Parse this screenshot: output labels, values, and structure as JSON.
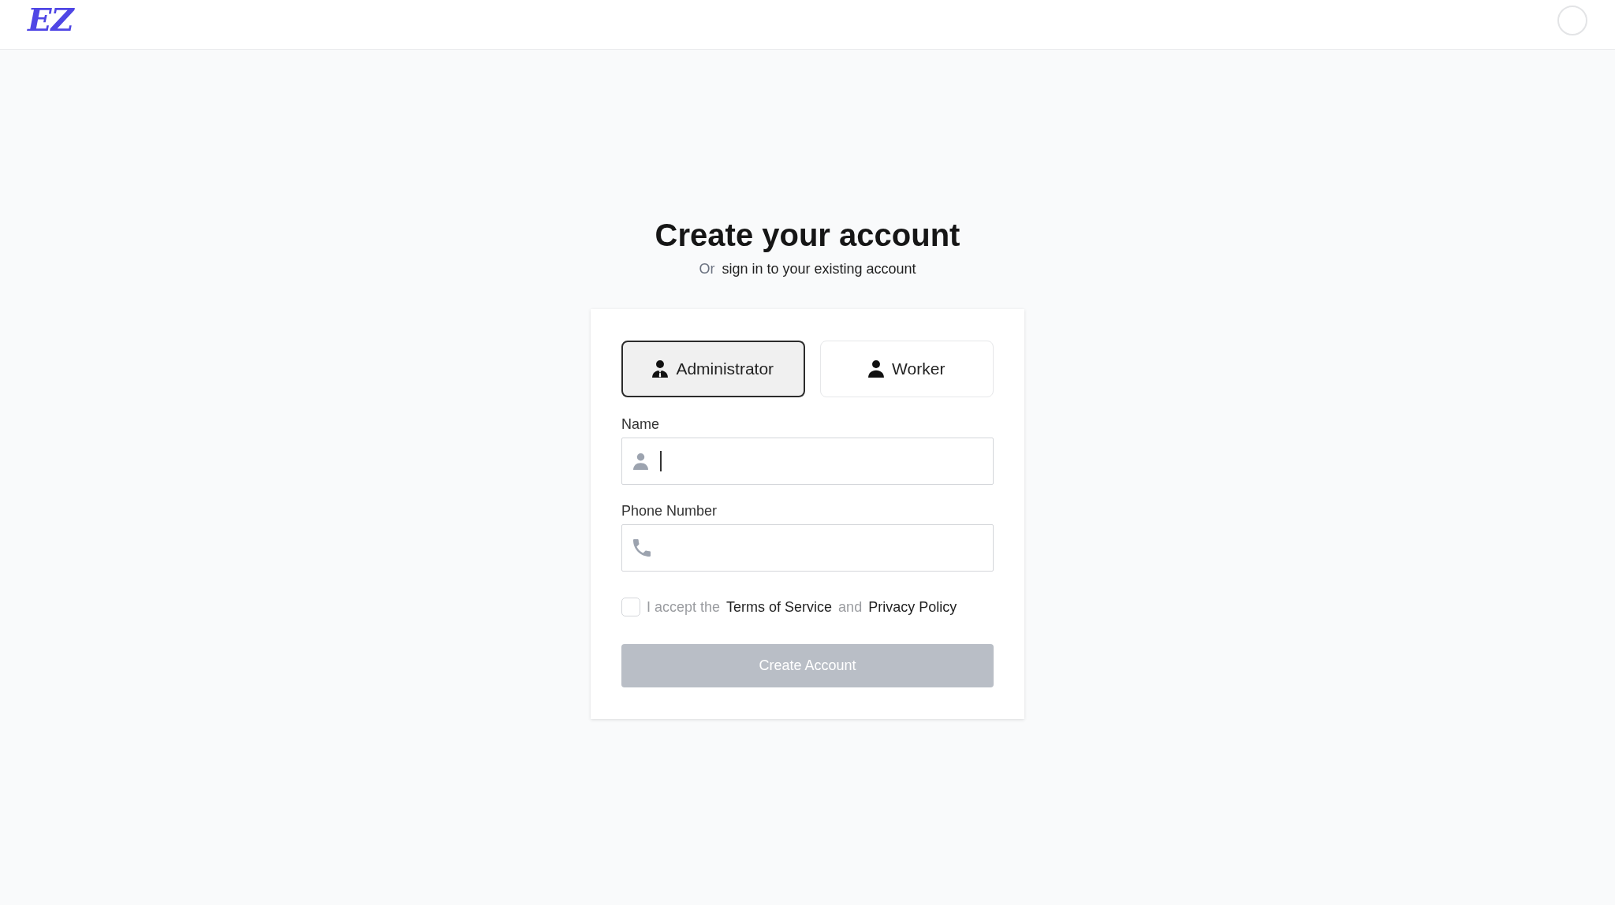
{
  "header": {
    "logo": "EZ"
  },
  "heading": "Create your account",
  "subtitle": {
    "prefix": "Or",
    "link": "sign in to your existing account"
  },
  "roles": [
    {
      "label": "Administrator",
      "kind": "administrator",
      "selected": true
    },
    {
      "label": "Worker",
      "kind": "worker",
      "selected": false
    }
  ],
  "fields": [
    {
      "label": "Name",
      "kind": "name",
      "focused": true
    },
    {
      "label": "Phone Number",
      "kind": "phone",
      "focused": false
    }
  ],
  "terms": {
    "checked": false,
    "parts": [
      {
        "text": "I accept the",
        "kind": "plain"
      },
      {
        "text": "Terms of Service",
        "kind": "link"
      },
      {
        "text": "and",
        "kind": "plain"
      },
      {
        "text": "Privacy Policy",
        "kind": "link"
      }
    ]
  },
  "submit": {
    "label": "Create Account",
    "disabled": true
  }
}
